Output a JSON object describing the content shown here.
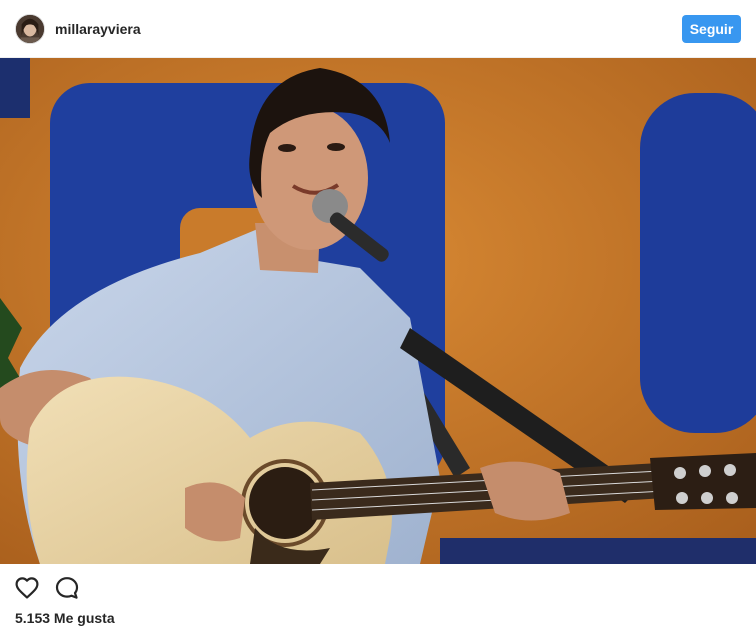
{
  "header": {
    "username": "millarayviera",
    "follow_label": "Seguir",
    "avatar_icon": "profile-avatar"
  },
  "photo": {
    "description_icon": "post-image"
  },
  "actions": {
    "like_icon": "heart-outline-icon",
    "comment_icon": "speech-bubble-icon"
  },
  "likes": {
    "text": "5.153 Me gusta"
  },
  "colors": {
    "accent": "#3897f0",
    "text": "#262626",
    "background": "#ffffff"
  }
}
